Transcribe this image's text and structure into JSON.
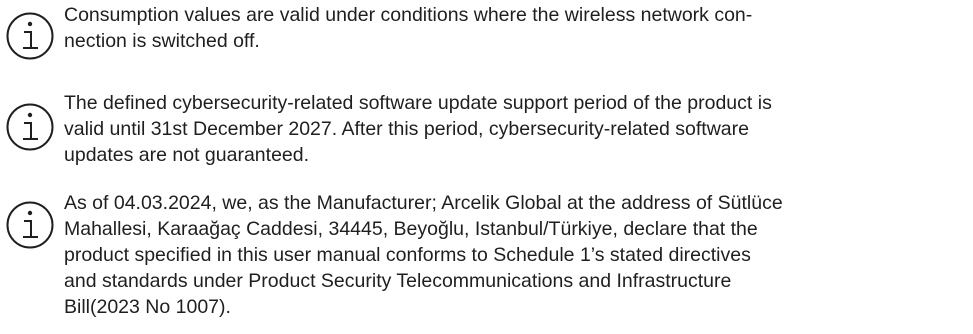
{
  "notes": [
    {
      "icon": "info-icon",
      "lines": [
        "Consumption values are valid under conditions where the wireless network con-",
        "nection is switched off."
      ]
    },
    {
      "icon": "info-icon",
      "lines": [
        "The defined cybersecurity-related software update support period of the product is",
        "valid until 31st December 2027. After this period, cybersecurity-related software",
        "updates are not guaranteed."
      ]
    },
    {
      "icon": "info-icon",
      "lines": [
        "As of 04.03.2024, we, as the Manufacturer; Arcelik Global at the address of Sütlüce",
        "Mahallesi, Karaağaç Caddesi, 34445, Beyoğlu, Istanbul/Türkiye, declare that the",
        "product specified in this user manual conforms to Schedule 1’s stated directives",
        "and standards under Product Security Telecommunications and Infrastructure",
        "Bill(2023 No 1007)."
      ]
    }
  ]
}
